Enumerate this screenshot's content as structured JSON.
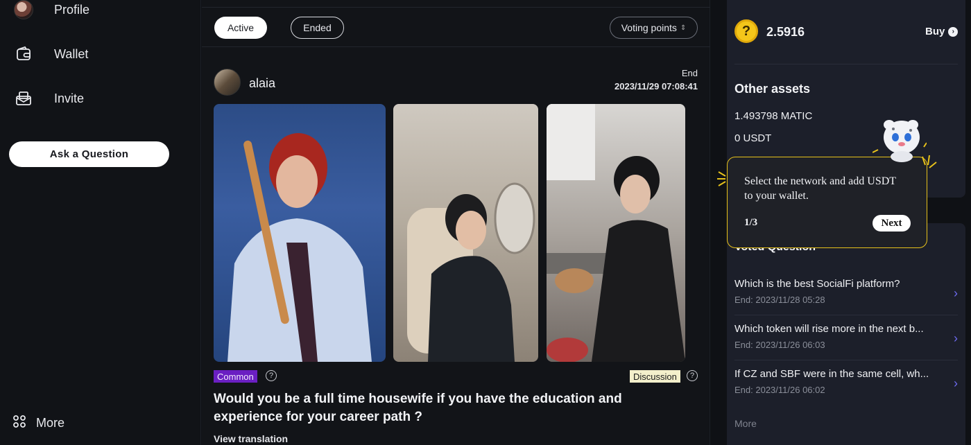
{
  "sidebar": {
    "items": [
      {
        "label": "Profile",
        "icon": "avatar"
      },
      {
        "label": "Wallet",
        "icon": "wallet-icon"
      },
      {
        "label": "Invite",
        "icon": "invite-icon"
      }
    ],
    "ask_button": "Ask a Question",
    "more_label": "More"
  },
  "filters": {
    "active": "Active",
    "ended": "Ended",
    "sort": "Voting points",
    "sort_icon": "sort-chevron-icon"
  },
  "post": {
    "username": "alaia",
    "end_label": "End",
    "end_date": "2023/11/29 07:08:41",
    "category": "Common",
    "type": "Discussion",
    "title": "Would you be a full time housewife if you have the education and experience for your career path ?",
    "translate": "View translation",
    "image_count": 3
  },
  "wallet": {
    "coin_symbol": "?",
    "balance": "2.5916",
    "buy": "Buy",
    "other_assets_title": "Other assets",
    "assets": [
      "1.493798 MATIC",
      "0 USDT"
    ]
  },
  "voted": {
    "title": "Voted Question",
    "items": [
      {
        "text": "Which is the best SocialFi platform?",
        "date": "End: 2023/11/28 05:28"
      },
      {
        "text": "Which token will rise more in the next b...",
        "date": "End: 2023/11/26 06:03"
      },
      {
        "text": "If CZ and SBF were in the same cell, wh...",
        "date": "End: 2023/11/26 06:02"
      }
    ],
    "more": "More"
  },
  "tooltip": {
    "text": "Select the network and add USDT to your wallet.",
    "step": "1/3",
    "next": "Next"
  },
  "colors": {
    "accent_purple": "#6a1fc2",
    "tooltip_border": "#e8c21b",
    "coin": "#f4c61a",
    "arrow": "#6d6af0"
  }
}
